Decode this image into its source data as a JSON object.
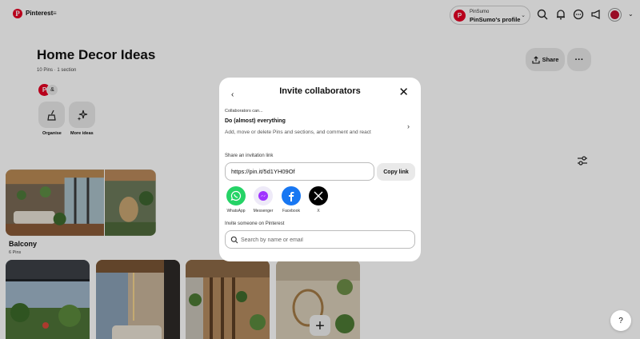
{
  "topbar": {
    "logo_letter": "P",
    "brand": "Pinterest",
    "menu_glyph": "≡",
    "profile_small": "PinSumo",
    "profile_name": "PinSumo's profile",
    "profile_initial": "P"
  },
  "board": {
    "title": "Home Decor Ideas",
    "meta": "10 Pins · 1 section",
    "collaborator_initial": "P",
    "share_label": "Share",
    "more_glyph": "···",
    "tools": [
      {
        "label": "Organise"
      },
      {
        "label": "More ideas"
      }
    ]
  },
  "section": {
    "title": "Balcony",
    "meta": "6 Pins"
  },
  "modal": {
    "title": "Invite collaborators",
    "back_glyph": "‹",
    "close_glyph": "✕",
    "permission_label": "Collaborators can...",
    "permission_title": "Do (almost) everything",
    "permission_desc": "Add, move or delete Pins and sections, and comment and react",
    "link_label": "Share an invitation link",
    "link_value": "https://pin.it/5d1YH09Of",
    "copy_label": "Copy link",
    "apps": [
      {
        "label": "WhatsApp",
        "icon": "whatsapp-icon",
        "color": "#25d366"
      },
      {
        "label": "Messenger",
        "icon": "messenger-icon",
        "color": "#a033ff"
      },
      {
        "label": "Facebook",
        "icon": "facebook-icon",
        "color": "#1877f2"
      },
      {
        "label": "X",
        "icon": "x-icon",
        "color": "#000000"
      }
    ],
    "invite_label": "Invite someone on Pinterest",
    "search_placeholder": "Search by name or email"
  },
  "colors": {
    "brand_red": "#e60023",
    "overlay": "rgba(0,0,0,0.2)"
  }
}
